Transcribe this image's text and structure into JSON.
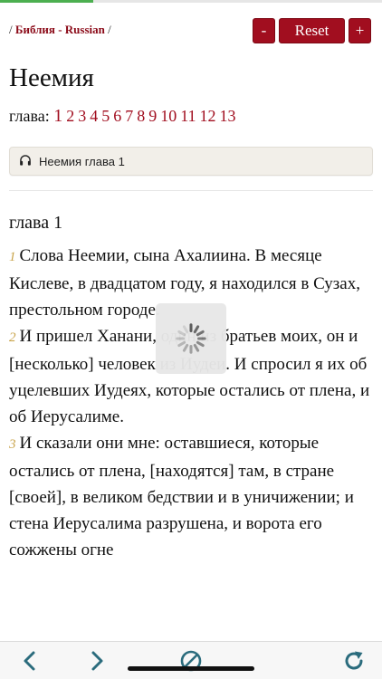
{
  "progress": {
    "fraction": 0.245,
    "color": "#4caf50"
  },
  "breadcrumb": {
    "prefix": "/ ",
    "link_label": "Библия - Russian",
    "suffix": " /"
  },
  "zoom": {
    "decrease_label": "-",
    "reset_label": "Reset",
    "increase_label": "+"
  },
  "book": {
    "title": "Неемия"
  },
  "chapters": {
    "label": "глава:",
    "items": [
      "1",
      "2",
      "3",
      "4",
      "5",
      "6",
      "7",
      "8",
      "9",
      "10",
      "11",
      "12",
      "13"
    ],
    "current": "1"
  },
  "audio": {
    "icon": "headphones-icon",
    "label": "Неемия глава 1"
  },
  "content": {
    "heading": "глава 1",
    "verses": [
      {
        "num": "1",
        "text": "Слова Неемии, сына Ахалиина. В месяце Кислеве, в двадцатом году, я находился в Сузах, престольном городе."
      },
      {
        "num": "2",
        "text": "И пришел Ханани, один из братьев моих, он и [несколько] человек из Иудеи. И спросил я их об уцелевших Иудеях, которые остались от плена, и об Иерусалиме."
      },
      {
        "num": "3",
        "text": "И сказали они мне: оставшиеся, которые остались от плена, [находятся] там, в стране [своей], в великом бедствии и в уничижении; и стена Иерусалима разрушена, и ворота его сожжены огне"
      }
    ]
  },
  "toolbar": {
    "back_icon": "chevron-left-icon",
    "forward_icon": "chevron-right-icon",
    "stop_icon": "stop-icon",
    "reload_icon": "reload-icon"
  },
  "colors": {
    "accent": "#a10e1f",
    "verse_number": "#c9a44b",
    "toolbar_icon": "#2b6c7d"
  }
}
